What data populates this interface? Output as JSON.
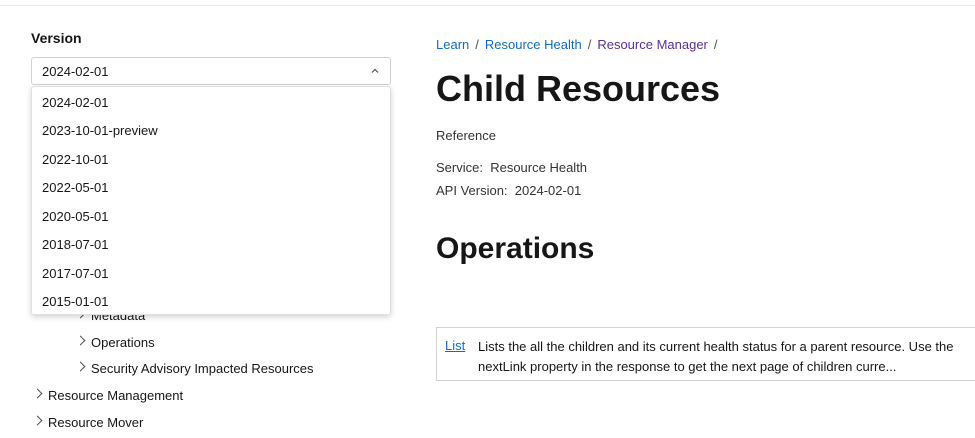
{
  "sidebar": {
    "version_label": "Version",
    "selected_version": "2024-02-01",
    "options": [
      "2024-02-01",
      "2023-10-01-preview",
      "2022-10-01",
      "2022-05-01",
      "2020-05-01",
      "2018-07-01",
      "2017-07-01",
      "2015-01-01"
    ],
    "tree": {
      "partial_item": "Metadata",
      "operations": "Operations",
      "security_advisory": "Security Advisory Impacted Resources",
      "resource_management": "Resource Management",
      "resource_mover": "Resource Mover"
    }
  },
  "breadcrumb": {
    "items": [
      "Learn",
      "Resource Health",
      "Resource Manager"
    ],
    "separator": "/"
  },
  "main": {
    "title": "Child Resources",
    "subtitle": "Reference",
    "service_label": "Service:",
    "service_value": "Resource Health",
    "api_version_label": "API Version:",
    "api_version_value": "2024-02-01",
    "operations_heading": "Operations",
    "operations": [
      {
        "name": "List",
        "description": "Lists the all the children and its current health status for a parent resource. Use the nextLink property in the response to get the next page of children curre..."
      }
    ]
  },
  "colors": {
    "link": "#0f6cbd",
    "visited_link": "#5c2e91"
  }
}
